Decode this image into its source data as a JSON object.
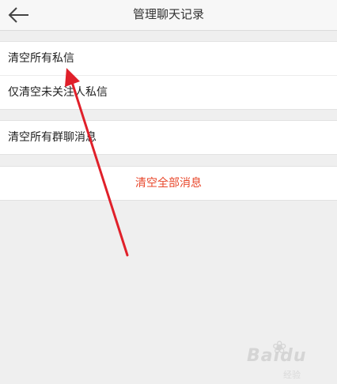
{
  "header": {
    "title": "管理聊天记录",
    "back_icon": "arrow-left-icon"
  },
  "groups": [
    {
      "items": [
        {
          "label": "清空所有私信"
        },
        {
          "label": "仅清空未关注人私信"
        }
      ]
    },
    {
      "items": [
        {
          "label": "清空所有群聊消息"
        }
      ]
    },
    {
      "items": [
        {
          "label": "清空全部消息",
          "color": "#e8472b"
        }
      ]
    }
  ],
  "annotation": {
    "color": "#e0202a",
    "icon": "red-arrow-annotation"
  },
  "watermark": {
    "brand": "Baidu",
    "sub": "经验"
  }
}
